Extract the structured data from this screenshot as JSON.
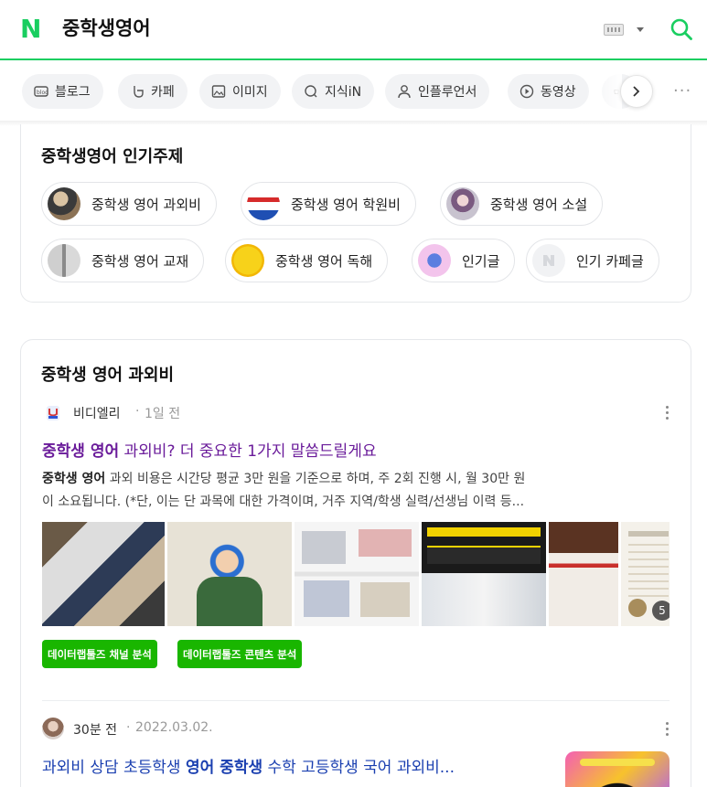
{
  "header": {
    "logo": "N",
    "query": "중학생영어"
  },
  "tabs": [
    {
      "label": "블로그",
      "icon": "blog-icon"
    },
    {
      "label": "카페",
      "icon": "cafe-icon"
    },
    {
      "label": "이미지",
      "icon": "image-icon"
    },
    {
      "label": "지식iN",
      "icon": "knowledge-icon"
    },
    {
      "label": "인플루언서",
      "icon": "influencer-icon"
    },
    {
      "label": "동영상",
      "icon": "video-icon"
    },
    {
      "label": "",
      "icon": "shopping-icon"
    }
  ],
  "popular": {
    "title": "중학생영어 인기주제",
    "chips": [
      {
        "label": "중학생 영어 과외비"
      },
      {
        "label": "중학생 영어 학원비"
      },
      {
        "label": "중학생 영어 소설"
      },
      {
        "label": "중학생 영어 교재"
      },
      {
        "label": "중학생 영어 독해"
      },
      {
        "label": "인기글"
      },
      {
        "label": "인기 카페글"
      }
    ]
  },
  "section": {
    "title": "중학생 영어 과외비",
    "post1": {
      "author": "비디엘리",
      "time": "1일 전",
      "title_hl": "중학생 영어",
      "title_rest": " 과외비? 더 중요한 1가지 말씀드릴게요",
      "desc_hl": "중학생 영어",
      "desc_rest1": " 과외 비용은 시간당 평균 3만 원을 기준으로 하며, 주 2회 진행 시, 월 30만 원",
      "desc_line2": "이 소요됩니다. (*단, 이는 단 과목에 대한 가격이며, 거주 지역/학생 실력/선생님 이력 등...",
      "image_count": "5",
      "buttons": [
        "데이터랩툴즈 채널 분석",
        "데이터랩툴즈 콘텐츠 분석"
      ]
    },
    "post2": {
      "author": "30분 전",
      "date": "2022.03.02.",
      "title_a": "과외비 상담 초등학생 ",
      "title_hl1": "영어 중학생",
      "title_b": " 수학 고등학생 국어 과외비..."
    }
  },
  "colors": {
    "brand_green": "#19ce60",
    "title_purple": "#6a1b9a",
    "link_blue": "#1a3fb0",
    "button_green": "#19b600"
  }
}
